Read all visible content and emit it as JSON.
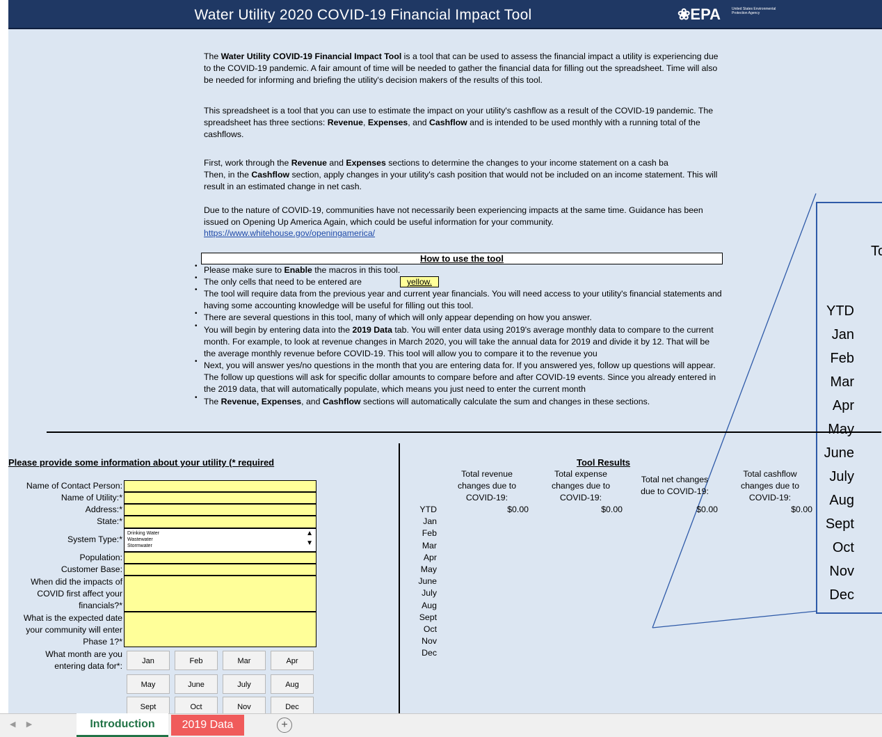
{
  "header": {
    "title": "Water Utility 2020 COVID-19 Financial Impact Tool",
    "logo": "❀EPA",
    "logo_sub": "United States Environmental Protection Agency"
  },
  "intro": {
    "p1_pre": "The ",
    "p1_bold": "Water Utility COVID-19 Financial Impact Tool",
    "p1_post": " is a tool that can be used to assess the financial impact a utility is experiencing due to the COVID-19 pandemic. A fair amount of time will be needed to gather the financial data for filling out the spreadsheet. Time will also be needed for informing and briefing the utility's decision makers of the results of this tool.",
    "p2_pre": "This spreadsheet is a tool that you can use to estimate the impact on your utility's cashflow as a result of the COVID-19 pandemic. The spreadsheet has three sections: ",
    "p2_b1": "Revenue",
    "p2_c1": ", ",
    "p2_b2": "Expenses",
    "p2_c2": ", and ",
    "p2_b3": "Cashflow",
    "p2_post": " and is intended to be used monthly with a running total of the cashflows.",
    "p3_a": "First, work through the ",
    "p3_b1": "Revenue",
    "p3_c": " and ",
    "p3_b2": "Expenses",
    "p3_d": " sections to determine the changes to your income statement on a cash ba",
    "p3_e": "Then, in the ",
    "p3_b3": "Cashflow",
    "p3_f": " section, apply changes in your utility's cash position that would not be included on an income statement. This will result in an estimated change in net cash.",
    "p4": "Due to the nature of COVID-19, communities have not necessarily been experiencing impacts at the same time. Guidance has been issued on Opening Up America Again, which could be useful information for your community.",
    "link": "https://www.whitehouse.gov/openingamerica/"
  },
  "howto": {
    "title": "How to use the tool",
    "b1_pre": "Please make sure to ",
    "b1_bold": "Enable",
    "b1_post": " the macros in this tool.",
    "b2": "The only cells that need to be entered are",
    "b2_cell": "yellow.",
    "b3": "The tool will require data from the previous year and current year financials. You will need access to your utility's financial statements and having some accounting knowledge will be useful for filling out this tool.",
    "b4": "There are several questions in this tool, many of which will only appear depending on how you answer.",
    "b5_pre": "You will begin by entering data into the ",
    "b5_bold": "2019 Data",
    "b5_post": " tab. You will enter data using 2019's average monthly data to compare to the current month. For example, to look at revenue changes in March 2020, you will take the annual data for 2019 and divide it by 12. That will be the average monthly revenue before COVID-19. This tool will allow you to compare it to the revenue you",
    "b6": "Next, you will answer yes/no questions in the month that you are entering data for. If you answered yes, follow up questions will appear. The follow up questions will ask for specific dollar amounts to compare before and after COVID-19 events. Since you already entered in the 2019 data, that will automatically populate, which means you just need to enter the current month",
    "b7_pre": "The ",
    "b7_bold1": "Revenue, Expenses",
    "b7_mid": ", and ",
    "b7_bold2": "Cashflow",
    "b7_post": " sections will automatically calculate the sum and changes in these sections."
  },
  "form": {
    "title": "Please provide some information about your utility (* required",
    "contact_label": "Name of Contact Person:",
    "utility_label": "Name of Utility:*",
    "address_label": "Address:*",
    "state_label": "State:*",
    "system_label": "System Type:*",
    "system_options": [
      "Drinking Water",
      "Wastewater",
      "Stormwater"
    ],
    "population_label": "Population:",
    "customer_label": "Customer Base:",
    "impact_label": "When did the impacts of COVID first affect your financials?*",
    "phase_label": "What is the expected date your community will enter Phase 1?*",
    "month_label": "What month are you entering data for*:",
    "month_buttons": [
      "Jan",
      "Feb",
      "Mar",
      "Apr",
      "May",
      "June",
      "July",
      "Aug",
      "Sept",
      "Oct",
      "Nov",
      "Dec"
    ]
  },
  "results": {
    "title": "Tool Results",
    "col1": "Total revenue changes due to COVID-19:",
    "col2": "Total expense changes due to COVID-19:",
    "col3": "Total net changes due to COVID-19:",
    "col4": "Total cashflow changes due to COVID-19:",
    "v1": "$0.00",
    "v2": "$0.00",
    "v3": "$0.00",
    "v4": "$0.00",
    "months": [
      "YTD",
      "Jan",
      "Feb",
      "Mar",
      "Apr",
      "May",
      "June",
      "July",
      "Aug",
      "Sept",
      "Oct",
      "Nov",
      "Dec"
    ]
  },
  "zoom": {
    "partial": "To",
    "months": [
      "YTD",
      "Jan",
      "Feb",
      "Mar",
      "Apr",
      "May",
      "June",
      "July",
      "Aug",
      "Sept",
      "Oct",
      "Nov",
      "Dec"
    ]
  },
  "tabs": {
    "intro": "Introduction",
    "data": "2019 Data",
    "add": "+"
  },
  "colors": {
    "header": "#1f3864",
    "background": "#dce6f2",
    "input": "#ffff99",
    "active_tab": "#217346",
    "data_tab": "#f05b5b"
  }
}
